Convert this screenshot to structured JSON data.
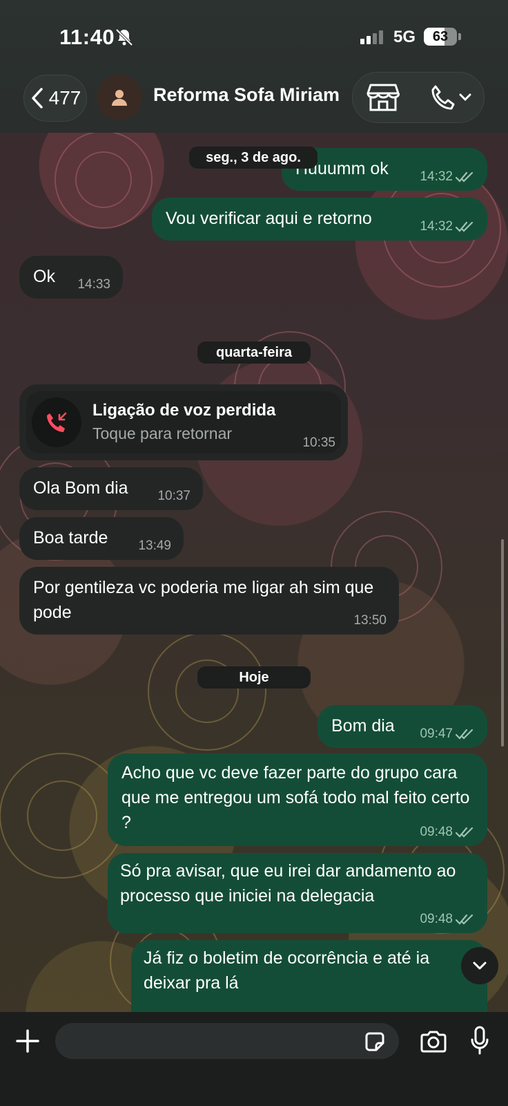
{
  "status_bar": {
    "time": "11:40",
    "network": "5G",
    "battery": "63",
    "battery_level": 0.63,
    "icons": [
      "bell-off-icon",
      "signal-icon",
      "battery-icon"
    ]
  },
  "header": {
    "back_count": "477",
    "title": "Reforma Sofa Miriam",
    "icons": [
      "chevron-left-icon",
      "avatar-person-icon",
      "store-icon",
      "phone-icon",
      "chevron-down-icon"
    ]
  },
  "chat": {
    "date_chips": {
      "first": "seg., 3 de ago.",
      "second": "quarta-feira",
      "third": "Hoje"
    },
    "messages": [
      {
        "dir": "out",
        "text": "Huuumm ok",
        "time": "14:32"
      },
      {
        "dir": "out",
        "text": "Vou verificar aqui e retorno",
        "time": "14:32"
      },
      {
        "dir": "in",
        "text": "Ok",
        "time": "14:33"
      },
      {
        "dir": "in",
        "text": "Ola Bom dia",
        "time": "10:37"
      },
      {
        "dir": "in",
        "text": "Boa tarde",
        "time": "13:49"
      },
      {
        "dir": "in",
        "text": "Por gentileza vc poderia me ligar ah sim que pode",
        "time": "13:50"
      },
      {
        "dir": "out",
        "text": "Bom dia",
        "time": "09:47"
      },
      {
        "dir": "out",
        "text": "Acho que vc deve fazer parte do grupo cara que me entregou um sofá todo mal feito certo ?",
        "time": "09:48"
      },
      {
        "dir": "out",
        "text": "Só pra avisar, que eu irei dar andamento ao processo que iniciei na delegacia",
        "time": "09:48"
      },
      {
        "dir": "out",
        "text": "Já fiz o boletim de ocorrência e até ia deixar pra lá",
        "time": ""
      }
    ],
    "missed_call": {
      "title": "Ligação de voz perdida",
      "subtitle": "Toque para retornar",
      "time": "10:35",
      "icon": "missed-call-icon"
    }
  },
  "input_bar": {
    "value": "",
    "icons": [
      "plus-icon",
      "sticker-icon",
      "camera-icon",
      "microphone-icon"
    ]
  },
  "colors": {
    "incoming_bubble": "#242626",
    "outgoing_bubble": "#144d37",
    "missed_call": "#ff4d5e"
  }
}
